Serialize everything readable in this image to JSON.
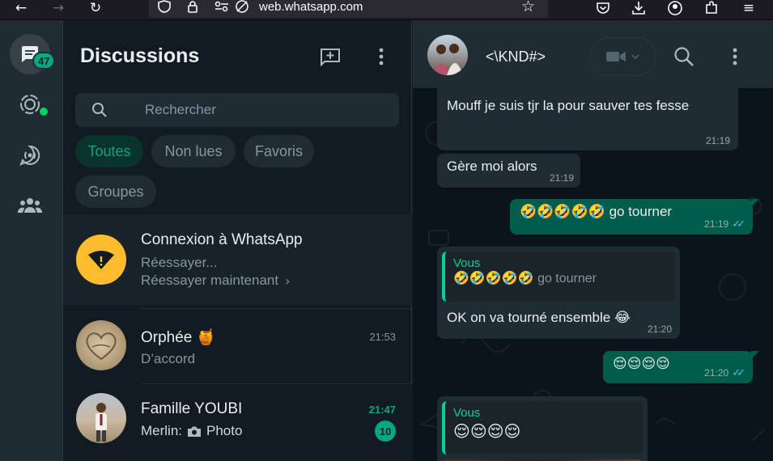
{
  "browser": {
    "url_host": "web.whatsapp.com"
  },
  "nav": {
    "chats_badge": "47"
  },
  "list": {
    "title": "Discussions",
    "search_placeholder": "Rechercher",
    "filters": [
      "Toutes",
      "Non lues",
      "Favoris",
      "Groupes"
    ],
    "connection": {
      "title": "Connexion à WhatsApp",
      "subtitle": "Réessayer...",
      "action": "Réessayer maintenant"
    },
    "chats": [
      {
        "name": "Orphée",
        "name_emoji": "🍯",
        "preview": "D’accord",
        "time": "21:53"
      },
      {
        "name": "Famille YOUBI",
        "preview_sender": "Merlin:",
        "preview": "Photo",
        "time": "21:47",
        "unread": "10"
      }
    ]
  },
  "conversation": {
    "contact_name": "<\\KND#>",
    "messages": [
      {
        "dir": "in",
        "text": "Mouff je suis tjr la pour sauver tes fesse",
        "time": "21:19"
      },
      {
        "dir": "in",
        "text": "Gère moi alors",
        "time": "21:19"
      },
      {
        "dir": "out",
        "emoji": "🤣🤣🤣🤣🤣",
        "text": "go tourner",
        "time": "21:19"
      },
      {
        "dir": "in",
        "quote_author": "Vous",
        "quote_emoji": "🤣🤣🤣🤣🤣",
        "quote_text": "go tourner",
        "text": "OK on va tourné ensemble",
        "emoji": "😂",
        "time": "21:20"
      },
      {
        "dir": "out",
        "emoji": "😌😌😌😌",
        "time": "21:20"
      },
      {
        "dir": "in",
        "quote_author": "Vous",
        "quote_emoji": "😌😌😌😌"
      }
    ]
  },
  "colors": {
    "accent": "#00a884",
    "bubble_out": "#005c4b",
    "bubble_in": "#202c33",
    "read_tick": "#53bdeb"
  }
}
